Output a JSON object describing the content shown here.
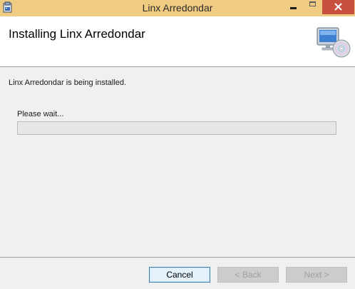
{
  "window": {
    "title": "Linx Arredondar",
    "title_bar_color": "#f0cc82",
    "close_button_color": "#c7503f",
    "app_icon": "installer-package-icon"
  },
  "header": {
    "title": "Installing Linx Arredondar",
    "icon": "computer-cd-icon"
  },
  "body": {
    "status_text": "Linx Arredondar is being installed.",
    "progress_label": "Please wait...",
    "progress_fraction": 0
  },
  "buttons": {
    "cancel_label": "Cancel",
    "back_label": "< Back",
    "next_label": "Next >"
  }
}
